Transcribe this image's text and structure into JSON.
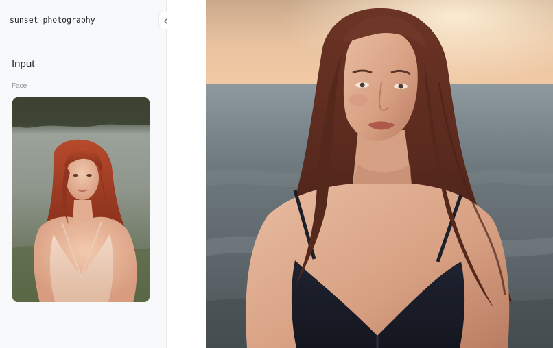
{
  "sidebar": {
    "prompt": "sunset photography",
    "section_title": "Input",
    "face_label": "Face"
  },
  "collapse_button": {
    "icon": "double-chevron-left-icon"
  },
  "input_image": {
    "icon": "face-input-photo"
  },
  "output_image": {
    "icon": "generated-sunset-portrait"
  },
  "colors": {
    "sidebar_bg": "#f8f9fb",
    "divider": "#d5d8dd",
    "text": "#1f2328",
    "muted_text": "#8a9099"
  }
}
